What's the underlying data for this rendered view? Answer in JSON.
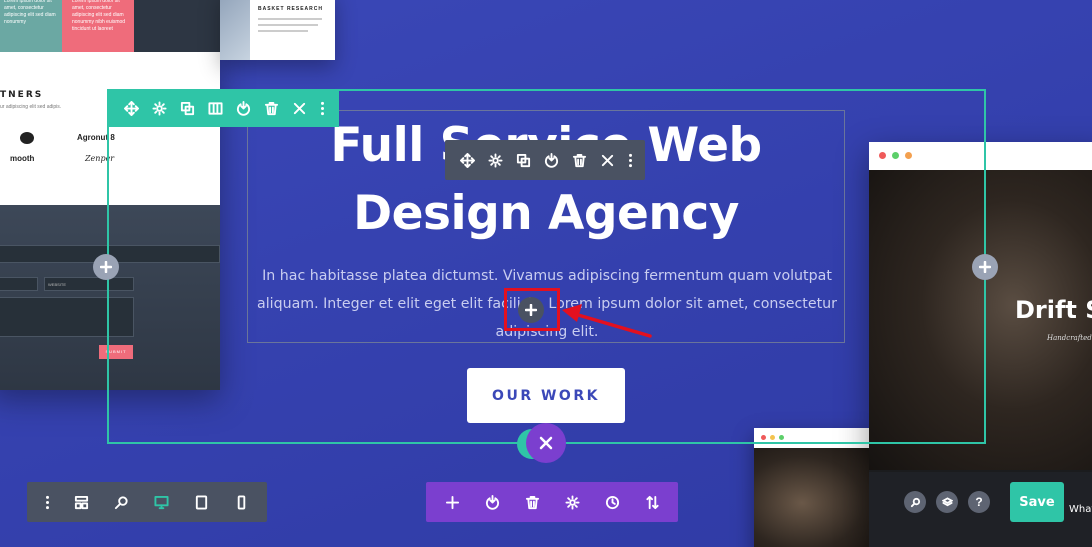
{
  "hero": {
    "title": "Full Service Web Design Agency",
    "body": "In hac habitasse platea dictumst. Vivamus adipiscing fermentum quam volutpat aliquam. Integer et elit eget elit facilisis. Lorem ipsum dolor sit amet, consectetur adipiscing elit.",
    "cta_label": "OUR WORK"
  },
  "left_mockup": {
    "partners_heading": "TNERS",
    "partners_sub": "ur adipiscing elit sed adipis.",
    "logos": [
      "Agronut 8",
      "mooth",
      "Zenper"
    ],
    "teal_text": "Lorem ipsum dolor sit\namet, consectetur\nadipiscing elit sed diam\nnonummy",
    "pink_text": "Lorem ipsum dolor sit\namet, consectetur\nadipiscing elit sed diam\nnonummy nibh euismod\ntincidunt ut laoreet",
    "website_placeholder": "WEBSITE",
    "submit_label": "SUBMIT"
  },
  "top_mockup": {
    "title": "BASKET RESEARCH"
  },
  "right_mockup": {
    "title": "Drift S",
    "subtitle": "Handcrafted W"
  },
  "bottom_right": {
    "save_label": "Save",
    "help_label": "?",
    "what_text": "What"
  },
  "colors": {
    "background": "#3b48b8",
    "section_accent": "#2fc5a7",
    "row_toolbar": "#4a5262",
    "page_toolbar": "#7b3fcf",
    "highlight": "#e3101f"
  },
  "icons": {
    "section_toolbar": [
      "move-icon",
      "settings-icon",
      "duplicate-icon",
      "columns-icon",
      "save-to-library-icon",
      "delete-icon",
      "close-icon",
      "more-icon"
    ],
    "row_toolbar": [
      "move-icon",
      "settings-icon",
      "duplicate-icon",
      "save-to-library-icon",
      "delete-icon",
      "close-icon",
      "more-icon"
    ],
    "bottom_left_toolbar": [
      "more-icon",
      "wireframe-icon",
      "zoom-icon",
      "desktop-view-icon",
      "tablet-view-icon",
      "phone-view-icon"
    ],
    "bottom_center_toolbar": [
      "add-icon",
      "load-layout-icon",
      "clear-layout-icon",
      "page-settings-icon",
      "history-icon",
      "portability-icon"
    ]
  }
}
